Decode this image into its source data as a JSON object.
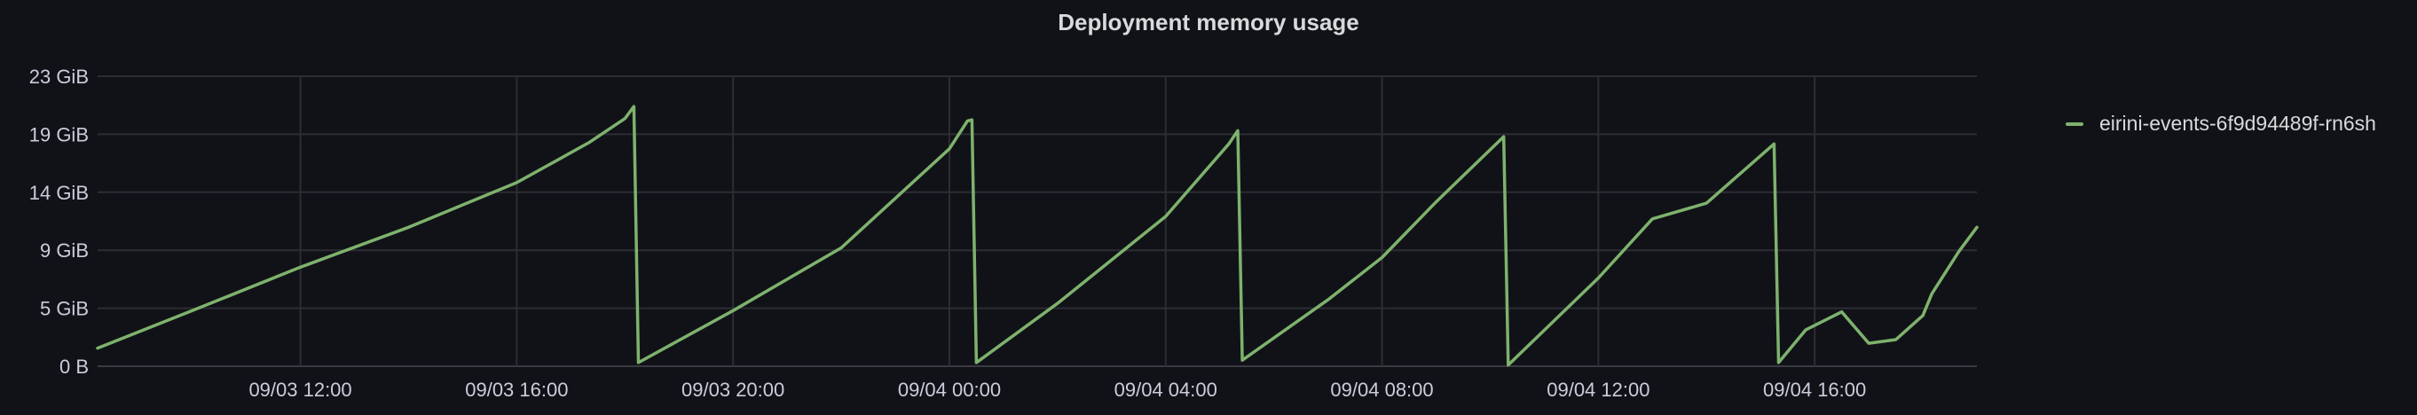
{
  "panel": {
    "title": "Deployment memory usage",
    "background": "#111217"
  },
  "chart_data": {
    "type": "line",
    "title": "Deployment memory usage",
    "xlabel": "",
    "ylabel": "",
    "x_unit": "time",
    "x_range": [
      "09/03 08:15",
      "09/04 19:00"
    ],
    "x_ticks": [
      "09/03 12:00",
      "09/03 16:00",
      "09/03 20:00",
      "09/04 00:00",
      "09/04 04:00",
      "09/04 08:00",
      "09/04 12:00",
      "09/04 16:00"
    ],
    "y_unit": "GiB",
    "y_ticks": [
      {
        "value": 0,
        "label": "0 B"
      },
      {
        "value": 4.8,
        "label": "5 GiB"
      },
      {
        "value": 9.6,
        "label": "9 GiB"
      },
      {
        "value": 14.4,
        "label": "14 GiB"
      },
      {
        "value": 19.2,
        "label": "19 GiB"
      },
      {
        "value": 24.0,
        "label": "23 GiB"
      }
    ],
    "ylim": [
      0,
      24.0
    ],
    "grid": true,
    "legend_position": "right",
    "series": [
      {
        "name": "eirini-events-6f9d94489f-rn6sh",
        "color": "#7eb26d",
        "points": [
          [
            "09/03 08:15",
            1.5
          ],
          [
            "09/03 10:00",
            4.6
          ],
          [
            "09/03 12:00",
            8.2
          ],
          [
            "09/03 14:00",
            11.5
          ],
          [
            "09/03 16:00",
            15.2
          ],
          [
            "09/03 17:20",
            18.5
          ],
          [
            "09/03 18:00",
            20.5
          ],
          [
            "09/03 18:10",
            21.5
          ],
          [
            "09/03 18:15",
            0.3
          ],
          [
            "09/03 20:00",
            4.6
          ],
          [
            "09/03 22:00",
            9.8
          ],
          [
            "09/04 00:00",
            18.0
          ],
          [
            "09/04 00:20",
            20.3
          ],
          [
            "09/04 00:25",
            20.4
          ],
          [
            "09/04 00:30",
            0.3
          ],
          [
            "09/04 02:00",
            5.2
          ],
          [
            "09/04 04:00",
            12.4
          ],
          [
            "09/04 05:10",
            18.4
          ],
          [
            "09/04 05:20",
            19.5
          ],
          [
            "09/04 05:25",
            0.5
          ],
          [
            "09/04 07:00",
            5.5
          ],
          [
            "09/04 08:00",
            9.0
          ],
          [
            "09/04 09:00",
            13.6
          ],
          [
            "09/04 10:15",
            19.0
          ],
          [
            "09/04 10:20",
            0.1
          ],
          [
            "09/04 12:00",
            7.3
          ],
          [
            "09/04 13:00",
            12.2
          ],
          [
            "09/04 14:00",
            13.5
          ],
          [
            "09/04 15:15",
            18.4
          ],
          [
            "09/04 15:20",
            0.3
          ],
          [
            "09/04 15:50",
            3.0
          ],
          [
            "09/04 16:30",
            4.5
          ],
          [
            "09/04 17:00",
            1.9
          ],
          [
            "09/04 17:30",
            2.2
          ],
          [
            "09/04 18:00",
            4.2
          ],
          [
            "09/04 18:10",
            6.0
          ],
          [
            "09/04 18:40",
            9.5
          ],
          [
            "09/04 19:00",
            11.5
          ]
        ]
      }
    ]
  }
}
